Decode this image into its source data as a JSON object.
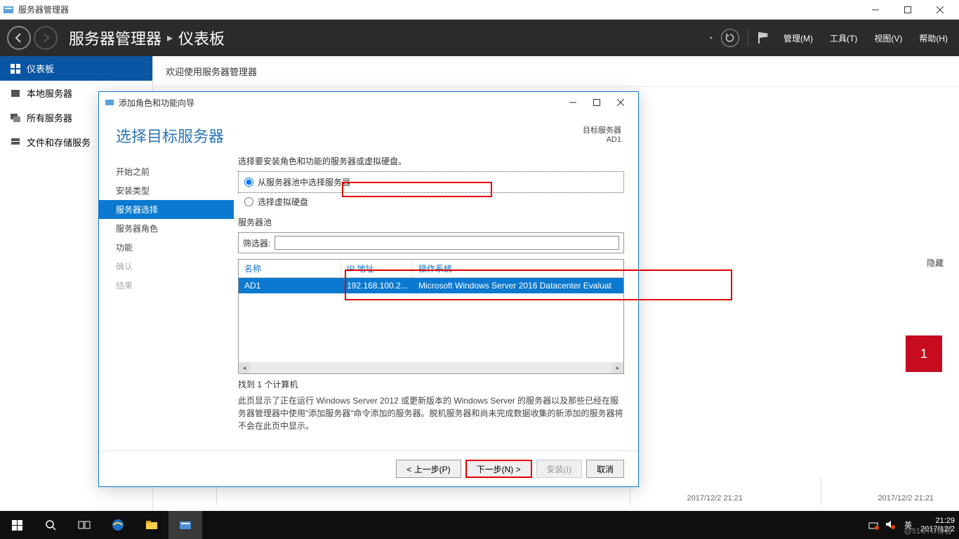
{
  "outer_window": {
    "title": "服务器管理器"
  },
  "cmdbar": {
    "breadcrumb_app": "服务器管理器",
    "breadcrumb_page": "仪表板",
    "menu_manage": "管理(M)",
    "menu_tools": "工具(T)",
    "menu_view": "视图(V)",
    "menu_help": "帮助(H)"
  },
  "sidebar": {
    "items": [
      {
        "label": "仪表板"
      },
      {
        "label": "本地服务器"
      },
      {
        "label": "所有服务器"
      },
      {
        "label": "文件和存储服务"
      }
    ]
  },
  "content": {
    "welcome": "欢迎使用服务器管理器",
    "hidden": "隐藏",
    "tile_value": "1",
    "timestamp": "2017/12/2 21:21"
  },
  "dialog": {
    "title": "添加角色和功能向导",
    "heading": "选择目标服务器",
    "target_label": "目标服务器",
    "target_value": "AD1",
    "steps": [
      "开始之前",
      "安装类型",
      "服务器选择",
      "服务器角色",
      "功能",
      "确认",
      "结果"
    ],
    "intro": "选择要安装角色和功能的服务器或虚拟硬盘。",
    "radio_pool": "从服务器池中选择服务器",
    "radio_vhd": "选择虚拟硬盘",
    "pool_label": "服务器池",
    "filter_label": "筛选器:",
    "columns": {
      "name": "名称",
      "ip": "IP 地址",
      "os": "操作系统"
    },
    "rows": [
      {
        "name": "AD1",
        "ip": "192.168.100.2...",
        "os": "Microsoft Windows Server 2016 Datacenter Evaluat"
      }
    ],
    "found": "找到 1 个计算机",
    "description": "此页显示了正在运行 Windows Server 2012 或更新版本的 Windows Server 的服务器以及那些已经在服务器管理器中使用\"添加服务器\"命令添加的服务器。脱机服务器和尚未完成数据收集的新添加的服务器将不会在此页中显示。",
    "btn_prev": "< 上一步(P)",
    "btn_next": "下一步(N) >",
    "btn_install": "安装(I)",
    "btn_cancel": "取消"
  },
  "taskbar": {
    "ime": "英",
    "time": "21:29",
    "date": "2017/12/2",
    "watermark": "@51CTO博客"
  }
}
